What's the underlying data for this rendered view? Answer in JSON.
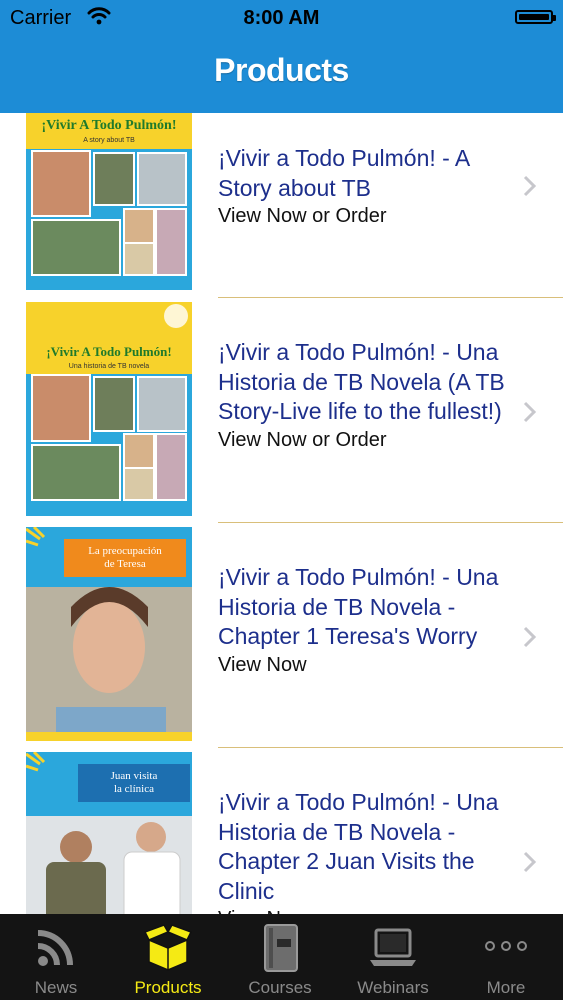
{
  "status_bar": {
    "carrier": "Carrier",
    "time": "8:00 AM"
  },
  "header": {
    "title": "Products"
  },
  "products": [
    {
      "title": "¡Vivir a Todo Pulmón! - A Story about TB",
      "action": "View Now or Order",
      "cover": {
        "heading": "¡Vivir A Todo Pulmón!",
        "subheading": "A story about TB"
      }
    },
    {
      "title": "¡Vivir a Todo Pulmón! - Una Historia de TB Novela (A TB Story-Live life to the fullest!)",
      "action": "View Now or Order",
      "cover": {
        "heading": "¡Vivir A Todo Pulmón!",
        "subheading": "Una historia de TB novela"
      }
    },
    {
      "title": "¡Vivir a Todo Pulmón! - Una Historia de TB Novela - Chapter 1 Teresa's Worry",
      "action": "View Now",
      "cover": {
        "heading": "La preocupación de Teresa"
      }
    },
    {
      "title": "¡Vivir a Todo Pulmón! - Una Historia de TB Novela - Chapter 2 Juan Visits the Clinic",
      "action": "View Now",
      "cover": {
        "heading": "Juan visita la clínica"
      }
    }
  ],
  "tabs": [
    {
      "label": "News",
      "icon": "news-feed-icon",
      "active": false
    },
    {
      "label": "Products",
      "icon": "box-icon",
      "active": true
    },
    {
      "label": "Courses",
      "icon": "book-icon",
      "active": false
    },
    {
      "label": "Webinars",
      "icon": "laptop-icon",
      "active": false
    },
    {
      "label": "More",
      "icon": "more-dots-icon",
      "active": false
    }
  ],
  "colors": {
    "header": "#1d8cd6",
    "item_title": "#1d2f8c",
    "separator": "#d9bf7a",
    "tab_active": "#f5ea14",
    "tab_inactive": "#8a8a8a",
    "tabbar": "#141414"
  }
}
